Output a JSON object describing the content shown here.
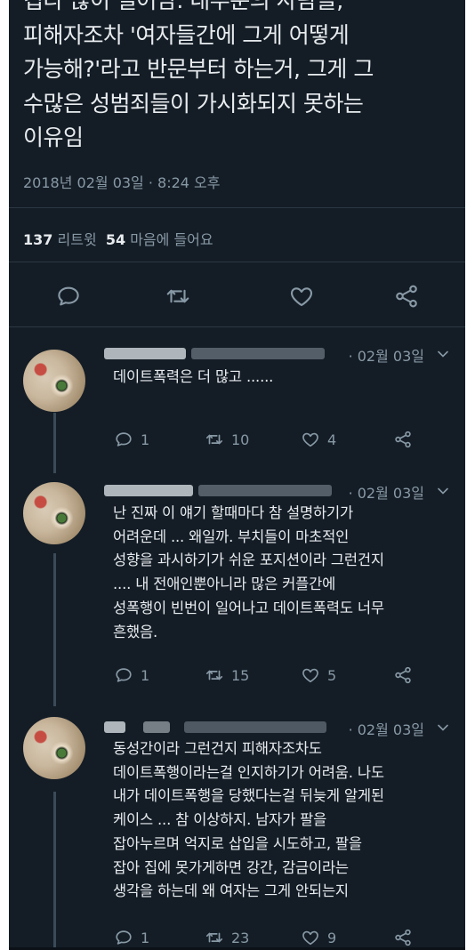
{
  "tweet": {
    "text_lines": [
      "컵다 많이 일어남. 내부분의 사람들,",
      "피해자조차 '여자들간에 그게 어떻게",
      "가능해?'라고 반문부터 하는거, 그게 그",
      "수많은 성범죄들이 가시화되지 못하는",
      "이유임"
    ],
    "timestamp": "2018년 02월 03일 · 8:24 오후",
    "retweet_count": "137",
    "retweet_label": "리트윗",
    "like_count": "54",
    "like_label": "마음에 들어요"
  },
  "actions": [
    {
      "name": "reply-icon"
    },
    {
      "name": "retweet-icon"
    },
    {
      "name": "like-icon"
    },
    {
      "name": "share-icon"
    }
  ],
  "replies": [
    {
      "date": "· 02월 03일",
      "lines": [
        "데이트폭력은 더 많고 ......"
      ],
      "reply_count": "1",
      "retweet_count": "10",
      "like_count": "4"
    },
    {
      "date": "· 02월 03일",
      "lines": [
        "난 진짜 이 얘기 할때마다 참 설명하기가",
        "어려운데 ... 왜일까. 부치들이 마초적인",
        "성향을 과시하기가 쉬운 포지션이라 그런건지",
        ".... 내 전애인뿐아니라 많은 커플간에",
        "성폭행이 빈번이 일어나고 데이트폭력도 너무",
        "흔했음."
      ],
      "reply_count": "1",
      "retweet_count": "15",
      "like_count": "5"
    },
    {
      "date": "· 02월 03일",
      "lines": [
        "동성간이라 그런건지 피해자조차도",
        "데이트폭행이라는걸 인지하기가 어려움. 나도",
        "내가 데이트폭행을 당했다는걸 뒤늦게 알게된",
        "케이스 ... 참 이상하지. 남자가 팔을",
        "잡아누르며 억지로 삽입을 시도하고, 팔을",
        "잡아 집에 못가게하면 강간, 감금이라는",
        "생각을 하는데 왜 여자는 그게 안되는지"
      ],
      "reply_count": "1",
      "retweet_count": "23",
      "like_count": "9"
    }
  ],
  "colors": {
    "background": "#141d26",
    "text": "#e8ecef",
    "muted": "#8899a6"
  }
}
